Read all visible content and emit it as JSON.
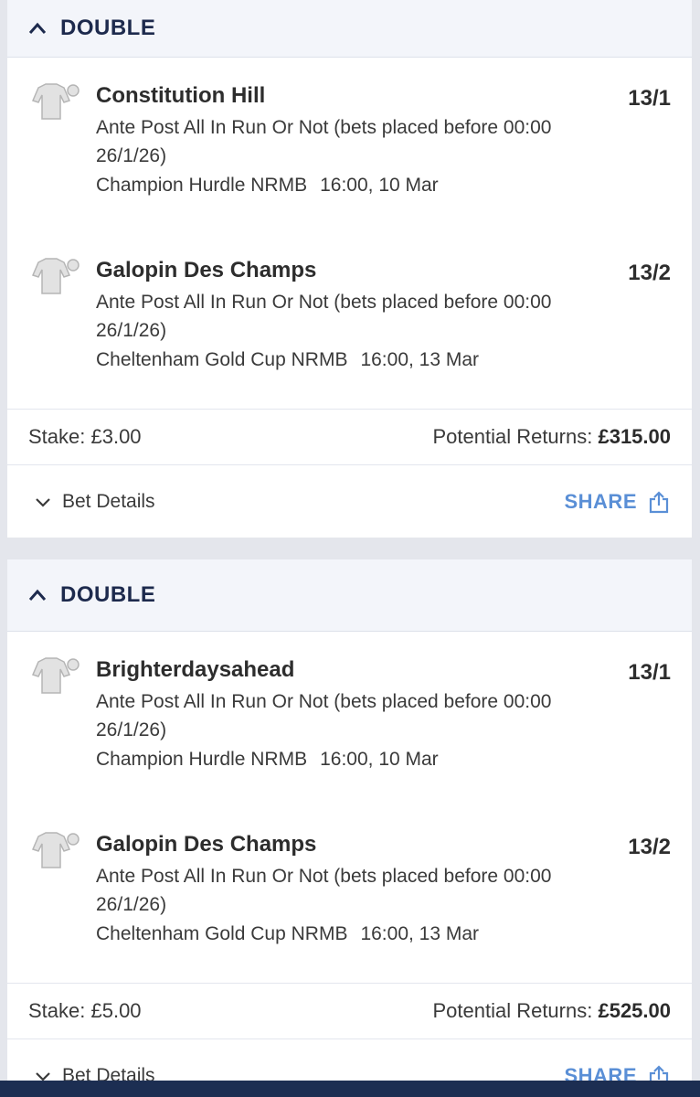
{
  "bets": [
    {
      "type": "DOUBLE",
      "selections": [
        {
          "name": "Constitution Hill",
          "odds": "13/1",
          "market": "Ante Post All In Run Or Not (bets placed before 00:00 26/1/26)",
          "event": "Champion Hurdle NRMB",
          "time": "16:00, 10 Mar"
        },
        {
          "name": "Galopin Des Champs",
          "odds": "13/2",
          "market": "Ante Post All In Run Or Not (bets placed before 00:00 26/1/26)",
          "event": "Cheltenham Gold Cup NRMB",
          "time": "16:00, 13 Mar"
        }
      ],
      "stake": "Stake: £3.00",
      "returns_label": "Potential Returns:",
      "returns_value": "£315.00",
      "details_label": "Bet Details",
      "share_label": "SHARE"
    },
    {
      "type": "DOUBLE",
      "selections": [
        {
          "name": "Brighterdaysahead",
          "odds": "13/1",
          "market": "Ante Post All In Run Or Not (bets placed before 00:00 26/1/26)",
          "event": "Champion Hurdle NRMB",
          "time": "16:00, 10 Mar"
        },
        {
          "name": "Galopin Des Champs",
          "odds": "13/2",
          "market": "Ante Post All In Run Or Not (bets placed before 00:00 26/1/26)",
          "event": "Cheltenham Gold Cup NRMB",
          "time": "16:00, 13 Mar"
        }
      ],
      "stake": "Stake: £5.00",
      "returns_label": "Potential Returns:",
      "returns_value": "£525.00",
      "details_label": "Bet Details",
      "share_label": "SHARE"
    }
  ],
  "colors": {
    "header_text": "#1d2a4d",
    "share_blue": "#5a8fd6",
    "bottom_bar": "#1c2e52"
  }
}
